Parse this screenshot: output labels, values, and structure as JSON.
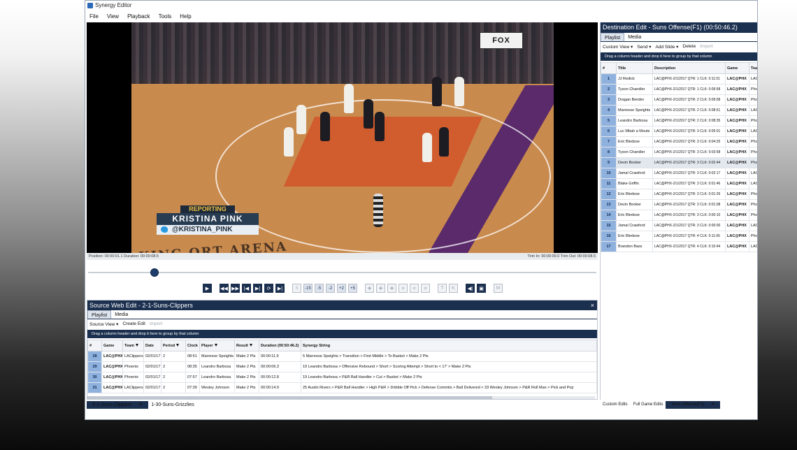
{
  "window": {
    "title": "Synergy Editor"
  },
  "menu": [
    "File",
    "View",
    "Playback",
    "Tools",
    "Help"
  ],
  "video": {
    "broadcast_bug": "FOX",
    "lower_third": {
      "label": "REPORTING",
      "name": "KRISTINA PINK",
      "handle": "@KRISTINA_PINK"
    },
    "arena_text": "KING  ORT ARENA",
    "status_left": "Position: 00:00:01.1   Duration: 00:00:08.5",
    "status_right": "Trim In: 00:00:00.0   Trim Out: 00:00:08.5",
    "progress": 0.13
  },
  "transport": {
    "buttons": [
      "play-icon",
      "rewind-icon",
      "fast-forward-icon",
      "skip-start-icon",
      "skip-end-icon",
      "loop-icon",
      "next-icon"
    ],
    "step_buttons": [
      "S",
      "-15",
      "-5",
      "-2",
      "+2",
      "+5"
    ],
    "tool_buttons": [
      "plus-icon",
      "plus-icon",
      "plus-icon",
      "x-icon",
      "x-icon",
      "x-icon"
    ],
    "extra_buttons": [
      "T",
      "export-icon",
      "audio-icon",
      "screen-icon",
      "M"
    ]
  },
  "source": {
    "title": "Source Web Edit - 2-1-Suns-Clippers",
    "close_label": "×",
    "tabs": [
      "Playlist",
      "Media"
    ],
    "toolbar": {
      "view": "Source View",
      "create": "Create Edit",
      "import": "Import"
    },
    "group_hint": "Drag a column header and drop it here to group by that column",
    "columns": [
      "#",
      "Game",
      "Team",
      "Date",
      "Period",
      "Clock",
      "Player",
      "Result",
      "Duration (00:50:46.2)",
      "Synergy String"
    ],
    "rows": [
      [
        "28",
        "LAC@PHX",
        "LAClippers",
        "02/01/17",
        "2",
        "08:51",
        "Marreese Speights",
        "Make 2 Pts",
        "00:00:11.9",
        "5 Marreese Speights > Transition > First Middle > To Basket > Make 2 Pts"
      ],
      [
        "29",
        "LAC@PHX",
        "Phoenix",
        "02/01/17",
        "2",
        "08:35",
        "Leandro Barbosa",
        "Make 2 Pts",
        "00:00:06.3",
        "19 Leandro Barbosa > Offensive Rebound > Short > Scoring Attempt > Short to < 17' > Make 2 Pts"
      ],
      [
        "30",
        "LAC@PHX",
        "Phoenix",
        "02/01/17",
        "2",
        "07:57",
        "Leandro Barbosa",
        "Make 2 Pts",
        "00:00:12.8",
        "19 Leandro Barbosa > P&R Ball Handler > Cut > Basket > Make 2 Pts"
      ],
      [
        "31",
        "LAC@PHX",
        "LAClippers",
        "02/01/17",
        "2",
        "07:39",
        "Wesley Johnson",
        "Make 2 Pts",
        "00:00:14.9",
        "25 Austin Rivers > P&R Ball Handler > High P&R > Dribble Off Pick > Defense Commits > Ball Delivered > 33 Wesley Johnson > P&R Roll Man > Pick and Pop"
      ]
    ],
    "bottom_tabs": [
      "2-1-Suns-Clippers",
      "1-30-Suns-Grizzlies"
    ]
  },
  "destination": {
    "title": "Destination Edit - Suns Offense(F1) (00:50:46.2)",
    "tabs": [
      "Playlist",
      "Media"
    ],
    "toolbar": {
      "view": "Custom View",
      "send": "Send",
      "slide": "Add Slide",
      "delete": "Delete",
      "import": "Import"
    },
    "group_hint": "Drag a column header and drop it here to group by that column",
    "columns": [
      "#",
      "Title",
      "Description",
      "Game",
      "Team"
    ],
    "rows": [
      [
        "1",
        "JJ Redick",
        "LAC@PHX-2/1/2017 QTR: 1 CLK: 0:11:01",
        "LAC@PHX",
        "LAClip"
      ],
      [
        "2",
        "Tyson Chandler",
        "LAC@PHX-2/1/2017 QTR: 1 CLK: 0:09:58",
        "LAC@PHX",
        "Phoen"
      ],
      [
        "3",
        "Dragan Bender",
        "LAC@PHX-2/1/2017 QTR: 2 CLK: 0:09:58",
        "LAC@PHX",
        "Phoen"
      ],
      [
        "4",
        "Marreese Speights",
        "LAC@PHX-2/1/2017 QTR: 2 CLK: 0:08:51",
        "LAC@PHX",
        "LAClip"
      ],
      [
        "5",
        "Leandro Barbosa",
        "LAC@PHX-2/1/2017 QTR: 2 CLK: 0:08:35",
        "LAC@PHX",
        "Phoen"
      ],
      [
        "6",
        "Luc Mbah a Moute",
        "LAC@PHX-2/1/2017 QTR: 3 CLK: 0:05:01",
        "LAC@PHX",
        "LAClip"
      ],
      [
        "7",
        "Eric Bledsoe",
        "LAC@PHX-2/1/2017 QTR: 3 CLK: 0:04:25",
        "LAC@PHX",
        "Phoen"
      ],
      [
        "8",
        "Tyson Chandler",
        "LAC@PHX-2/1/2017 QTR: 3 CLK: 0:03:58",
        "LAC@PHX",
        "Phoen"
      ],
      [
        "9",
        "Devin Booker",
        "LAC@PHX-2/1/2017 QTR: 3 CLK: 0:02:44",
        "LAC@PHX",
        "Phoen"
      ],
      [
        "10",
        "Jamal Crawford",
        "LAC@PHX-2/1/2017 QTR: 3 CLK: 0:02:17",
        "LAC@PHX",
        "LAClip"
      ],
      [
        "11",
        "Blake Griffin",
        "LAC@PHX-2/1/2017 QTR: 3 CLK: 0:01:46",
        "LAC@PHX",
        "LAClip"
      ],
      [
        "12",
        "Eric Bledsoe",
        "LAC@PHX-2/1/2017 QTR: 3 CLK: 0:01:26",
        "LAC@PHX",
        "Phoen"
      ],
      [
        "13",
        "Devin Booker",
        "LAC@PHX-2/1/2017 QTR: 3 CLK: 0:01:08",
        "LAC@PHX",
        "Phoen"
      ],
      [
        "14",
        "Eric Bledsoe",
        "LAC@PHX-2/1/2017 QTR: 3 CLK: 0:00:10",
        "LAC@PHX",
        "Phoen"
      ],
      [
        "15",
        "Jamal Crawford",
        "LAC@PHX-2/1/2017 QTR: 3 CLK: 0:00:00",
        "LAC@PHX",
        "LAClip"
      ],
      [
        "16",
        "Eric Bledsoe",
        "LAC@PHX-2/1/2017 QTR: 4 CLK: 0:11:06",
        "LAC@PHX",
        "Phoen"
      ],
      [
        "17",
        "Brandon Bass",
        "LAC@PHX-2/1/2017 QTR: 4 CLK: 0:10:44",
        "LAC@PHX",
        "LAClip"
      ]
    ],
    "bottom_tabs": [
      "Custom Edits",
      "Full Game Edits",
      "Suns Offense(F1)"
    ]
  },
  "colors": {
    "accent": "#1b2f4f",
    "row_highlight": "#8fb1de"
  }
}
